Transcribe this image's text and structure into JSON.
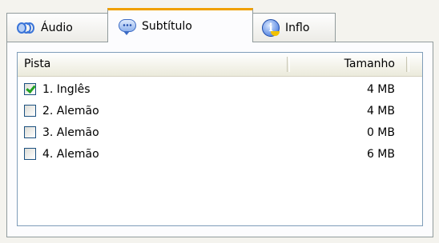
{
  "tabs": [
    {
      "label": "Áudio",
      "icon": "audio-icon",
      "active": false
    },
    {
      "label": "Subtítulo",
      "icon": "subtitle-icon",
      "active": true
    },
    {
      "label": "Inflo",
      "icon": "info-icon",
      "active": false
    }
  ],
  "table": {
    "columns": [
      "Pista",
      "Tamanho"
    ],
    "rows": [
      {
        "label": "1. Inglês",
        "size": "4 MB",
        "checked": true
      },
      {
        "label": "2. Alemão",
        "size": "4 MB",
        "checked": false
      },
      {
        "label": "3. Alemão",
        "size": "0 MB",
        "checked": false
      },
      {
        "label": "4. Alemão",
        "size": "6 MB",
        "checked": false
      }
    ]
  },
  "colors": {
    "active_tab_accent": "#f0a000",
    "check_mark": "#21a121",
    "list_border": "#7f9db9"
  }
}
